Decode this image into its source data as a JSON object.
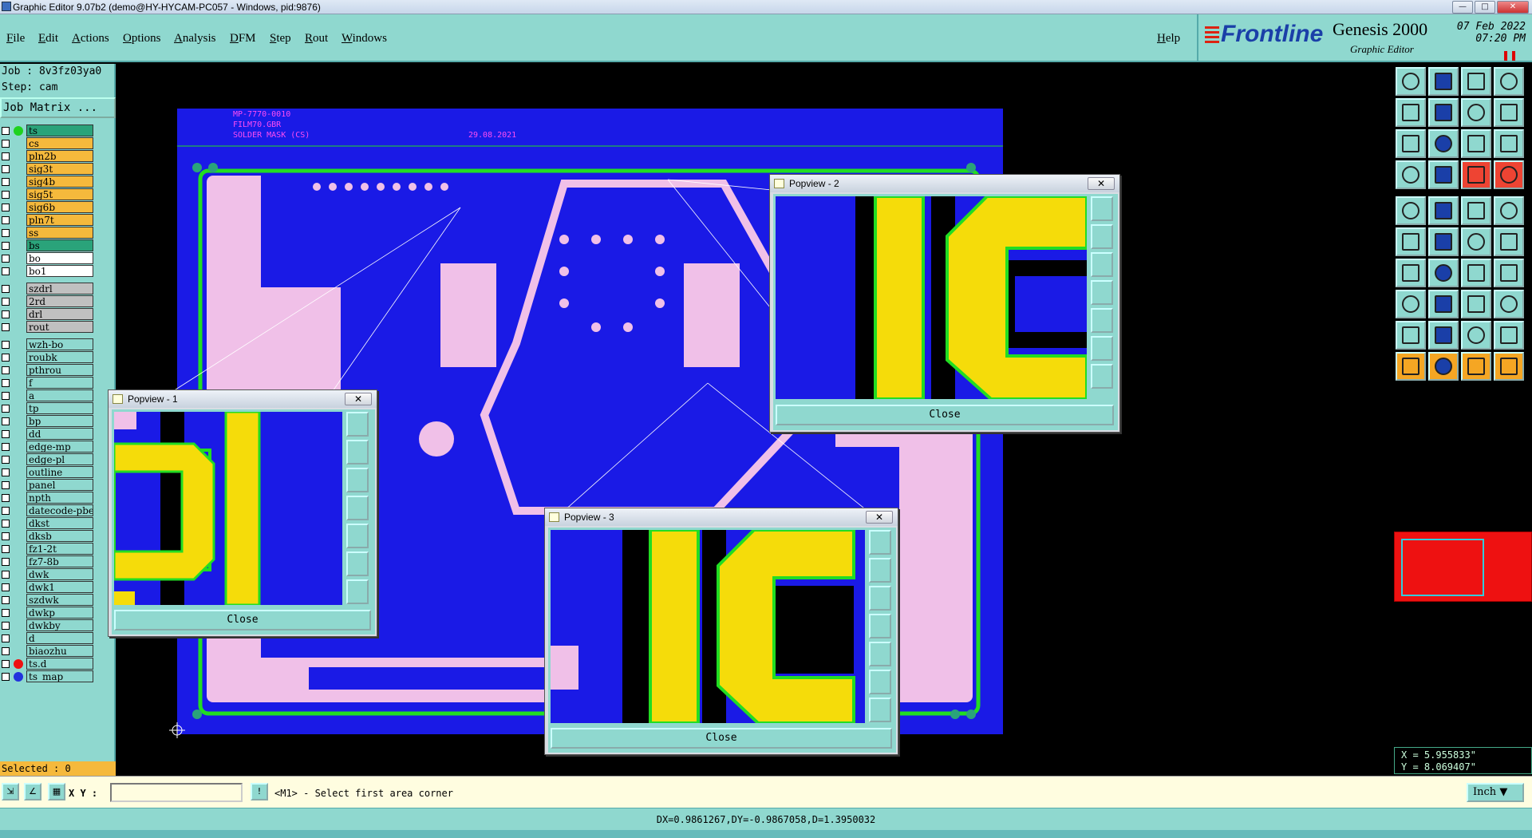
{
  "window": {
    "title": "Graphic Editor 9.07b2 (demo@HY-HYCAM-PC057 - Windows, pid:9876)"
  },
  "menu": {
    "items": [
      "File",
      "Edit",
      "Actions",
      "Options",
      "Analysis",
      "DFM",
      "Step",
      "Rout",
      "Windows"
    ],
    "help": "Help"
  },
  "brand": {
    "logo": "Frontline",
    "product": "Genesis 2000",
    "subtitle": "Graphic Editor",
    "date": "07 Feb 2022",
    "time": "07:20 PM"
  },
  "job": {
    "job_line": "Job : 8v3fz03ya0",
    "step_line": "Step: cam",
    "job_matrix": "Job Matrix ..."
  },
  "layers": [
    {
      "name": "ts",
      "bg": "#2aa37a",
      "dot": "#1fd21f"
    },
    {
      "name": "cs",
      "bg": "#f5b93c"
    },
    {
      "name": "pln2b",
      "bg": "#f5b93c"
    },
    {
      "name": "sig3t",
      "bg": "#f5b93c"
    },
    {
      "name": "sig4b",
      "bg": "#f5b93c"
    },
    {
      "name": "sig5t",
      "bg": "#f5b93c"
    },
    {
      "name": "sig6b",
      "bg": "#f5b93c"
    },
    {
      "name": "pln7t",
      "bg": "#f5b93c"
    },
    {
      "name": "ss",
      "bg": "#f5b93c"
    },
    {
      "name": "bs",
      "bg": "#2aa37a"
    },
    {
      "name": "bo",
      "bg": "#ffffff"
    },
    {
      "name": "bo1",
      "bg": "#ffffff"
    },
    {
      "name": "szdrl",
      "bg": "#c0c0c0",
      "gap": true
    },
    {
      "name": "2rd",
      "bg": "#c0c0c0"
    },
    {
      "name": "drl",
      "bg": "#c0c0c0"
    },
    {
      "name": "rout",
      "bg": "#c0c0c0"
    },
    {
      "name": "wzh-bo",
      "bg": "#8fd8cf",
      "gap": true
    },
    {
      "name": "roubk",
      "bg": "#8fd8cf"
    },
    {
      "name": "pthrou",
      "bg": "#8fd8cf"
    },
    {
      "name": "f",
      "bg": "#8fd8cf"
    },
    {
      "name": "a",
      "bg": "#8fd8cf"
    },
    {
      "name": "tp",
      "bg": "#8fd8cf"
    },
    {
      "name": "bp",
      "bg": "#8fd8cf"
    },
    {
      "name": "dd",
      "bg": "#8fd8cf"
    },
    {
      "name": "edge-mp",
      "bg": "#8fd8cf"
    },
    {
      "name": "edge-pl",
      "bg": "#8fd8cf"
    },
    {
      "name": "outline",
      "bg": "#8fd8cf"
    },
    {
      "name": "panel",
      "bg": "#8fd8cf"
    },
    {
      "name": "npth",
      "bg": "#8fd8cf"
    },
    {
      "name": "datecode-pbe",
      "bg": "#8fd8cf"
    },
    {
      "name": "dkst",
      "bg": "#8fd8cf"
    },
    {
      "name": "dksb",
      "bg": "#8fd8cf"
    },
    {
      "name": "fz1-2t",
      "bg": "#8fd8cf"
    },
    {
      "name": "fz7-8b",
      "bg": "#8fd8cf"
    },
    {
      "name": "dwk",
      "bg": "#8fd8cf"
    },
    {
      "name": "dwk1",
      "bg": "#8fd8cf"
    },
    {
      "name": "szdwk",
      "bg": "#8fd8cf"
    },
    {
      "name": "dwkp",
      "bg": "#8fd8cf"
    },
    {
      "name": "dwkby",
      "bg": "#8fd8cf"
    },
    {
      "name": "d",
      "bg": "#8fd8cf"
    },
    {
      "name": "biaozhu",
      "bg": "#8fd8cf"
    },
    {
      "name": "ts.d",
      "bg": "#8fd8cf",
      "dot": "#e11"
    },
    {
      "name": "ts_map",
      "bg": "#8fd8cf",
      "dot": "#2233dd"
    }
  ],
  "selected": "Selected : 0",
  "board": {
    "part": "MP-7770-0010",
    "file": "FILM70.GBR",
    "layer": "SOLDER MASK (CS)",
    "date": "29.08.2021"
  },
  "popviews": {
    "p1": {
      "title": "Popview - 1",
      "close_label": "Close"
    },
    "p2": {
      "title": "Popview - 2",
      "close_label": "Close"
    },
    "p3": {
      "title": "Popview - 3",
      "close_label": "Close"
    }
  },
  "status": {
    "xy_label": "X Y :",
    "xy_value": "",
    "prompt": "<M1> - Select first area corner",
    "units": "Inch",
    "measure": "DX=0.9861267,DY=-0.9867058,D=1.3950032"
  },
  "coords": {
    "x": "X = 5.955833\"",
    "y": "Y = 8.069407\""
  },
  "colors": {
    "panel": "#8fd8cf",
    "board": "#1a1ae6",
    "mask": "#f0c0e8",
    "copper": "#f5dc0a",
    "edge": "#22dd22"
  }
}
